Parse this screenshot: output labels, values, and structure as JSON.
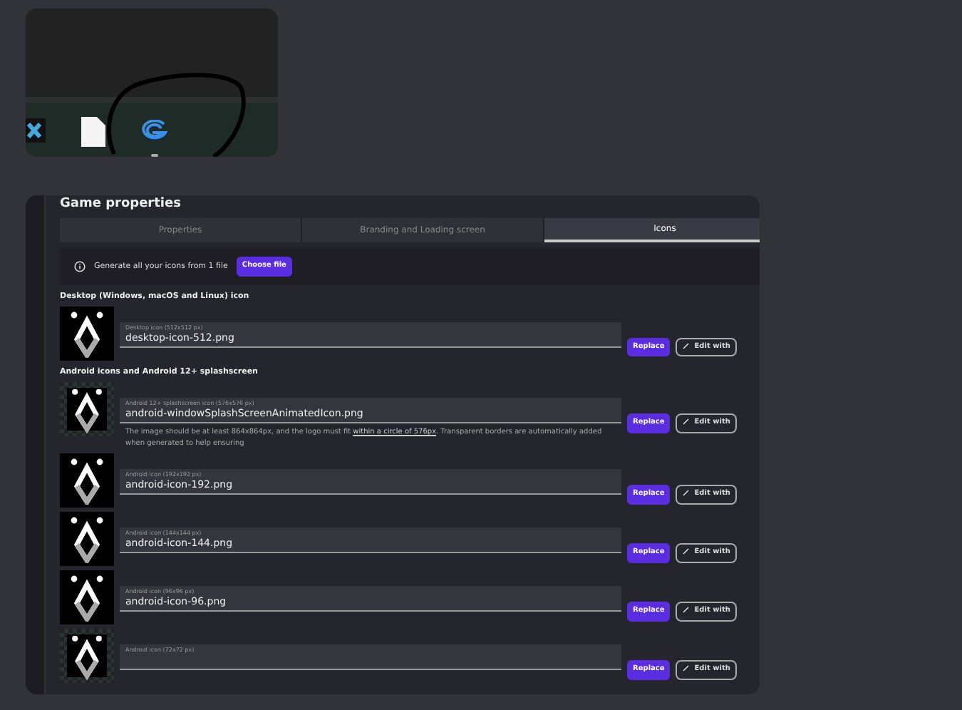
{
  "dialog": {
    "title": "Game properties",
    "tabs": [
      {
        "label": "Properties",
        "selected": false
      },
      {
        "label": "Branding and Loading screen",
        "selected": false
      },
      {
        "label": "Icons",
        "selected": true
      }
    ],
    "banner": {
      "text": "Generate all your icons from 1 file",
      "button": "Choose file"
    },
    "sections": [
      {
        "heading": "Desktop (Windows, macOS and Linux) icon",
        "items": [
          {
            "label": "Desktop icon (512x512 px)",
            "filename": "desktop-icon-512.png",
            "checkered": false,
            "replace": "Replace",
            "edit": "Edit with"
          }
        ]
      },
      {
        "heading": "Android icons and Android 12+ splashscreen",
        "items": [
          {
            "label": "Android 12+ splashscreen icon (576x576 px)",
            "filename": "android-windowSplashScreenAnimatedIcon.png",
            "checkered": true,
            "replace": "Replace",
            "edit": "Edit with",
            "note": {
              "before": "The image should be at least 864x864px, and the logo must fit ",
              "link": "within a circle of 576px",
              "after": ". Transparent borders are automatically added when generated to help ensuring"
            }
          },
          {
            "label": "Android icon (192x192 px)",
            "filename": "android-icon-192.png",
            "checkered": false,
            "replace": "Replace",
            "edit": "Edit with"
          },
          {
            "label": "Android icon (144x144 px)",
            "filename": "android-icon-144.png",
            "checkered": false,
            "replace": "Replace",
            "edit": "Edit with"
          },
          {
            "label": "Android icon (96x96 px)",
            "filename": "android-icon-96.png",
            "checkered": false,
            "replace": "Replace",
            "edit": "Edit with"
          },
          {
            "label": "Android icon (72x72 px)",
            "checkered": true,
            "replace": "Replace",
            "edit": "Edit with"
          }
        ]
      }
    ]
  }
}
